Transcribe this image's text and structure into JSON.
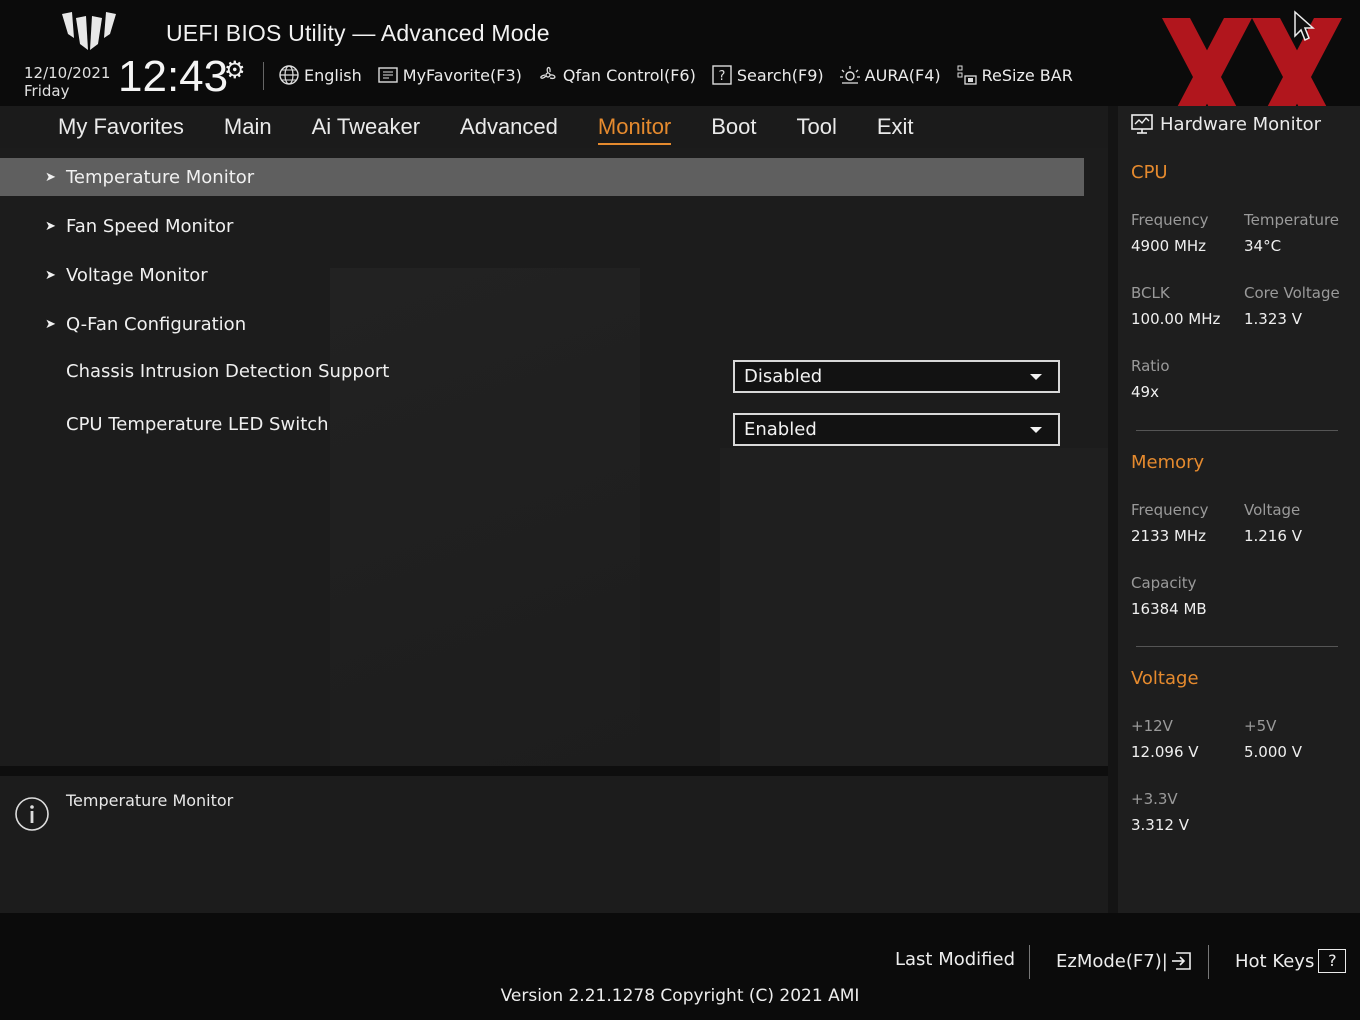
{
  "header": {
    "title": "UEFI BIOS Utility — Advanced Mode",
    "date": "12/10/2021",
    "day": "Friday",
    "time": "12:43",
    "toolbar": [
      {
        "label": "English",
        "icon": "globe-icon"
      },
      {
        "label": "MyFavorite(F3)",
        "icon": "favorite-icon"
      },
      {
        "label": "Qfan Control(F6)",
        "icon": "fan-icon"
      },
      {
        "label": "Search(F9)",
        "icon": "search-help-icon"
      },
      {
        "label": "AURA(F4)",
        "icon": "aura-light-icon"
      },
      {
        "label": "ReSize BAR",
        "icon": "resize-bar-icon"
      }
    ]
  },
  "tabs": [
    {
      "label": "My Favorites",
      "active": false
    },
    {
      "label": "Main",
      "active": false
    },
    {
      "label": "Ai Tweaker",
      "active": false
    },
    {
      "label": "Advanced",
      "active": false
    },
    {
      "label": "Monitor",
      "active": true
    },
    {
      "label": "Boot",
      "active": false
    },
    {
      "label": "Tool",
      "active": false
    },
    {
      "label": "Exit",
      "active": false
    }
  ],
  "menu": {
    "submenus": [
      {
        "label": "Temperature Monitor",
        "selected": true
      },
      {
        "label": "Fan Speed Monitor",
        "selected": false
      },
      {
        "label": "Voltage Monitor",
        "selected": false
      },
      {
        "label": "Q-Fan Configuration",
        "selected": false
      }
    ],
    "settings": [
      {
        "label": "Chassis Intrusion Detection Support",
        "value": "Disabled"
      },
      {
        "label": "CPU Temperature LED Switch",
        "value": "Enabled"
      }
    ]
  },
  "help": {
    "text": "Temperature Monitor"
  },
  "hw_monitor": {
    "title": "Hardware Monitor",
    "cpu": {
      "heading": "CPU",
      "frequency_label": "Frequency",
      "frequency": "4900 MHz",
      "temperature_label": "Temperature",
      "temperature": "34°C",
      "bclk_label": "BCLK",
      "bclk": "100.00 MHz",
      "core_voltage_label": "Core Voltage",
      "core_voltage": "1.323 V",
      "ratio_label": "Ratio",
      "ratio": "49x"
    },
    "memory": {
      "heading": "Memory",
      "frequency_label": "Frequency",
      "frequency": "2133 MHz",
      "voltage_label": "Voltage",
      "voltage": "1.216 V",
      "capacity_label": "Capacity",
      "capacity": "16384 MB"
    },
    "voltage": {
      "heading": "Voltage",
      "v12_label": "+12V",
      "v12": "12.096 V",
      "v5_label": "+5V",
      "v5": "5.000 V",
      "v33_label": "+3.3V",
      "v33": "3.312 V"
    }
  },
  "footer": {
    "last_modified": "Last Modified",
    "ezmode": "EzMode(F7)|",
    "hotkeys": "Hot Keys",
    "hotkeys_symbol": "?",
    "version": "Version 2.21.1278 Copyright (C) 2021 AMI"
  },
  "colors": {
    "accent": "#e58a2e",
    "selected_row": "#5f5f5f",
    "watermark": "#c0181f"
  }
}
